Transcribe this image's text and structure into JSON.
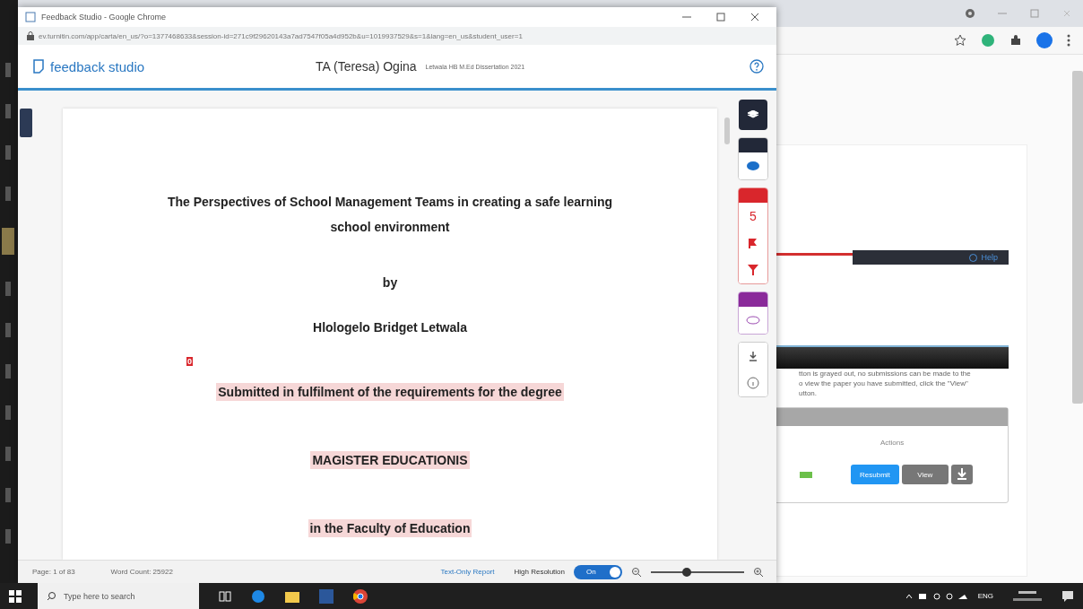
{
  "popup": {
    "title": "Feedback Studio - Google Chrome",
    "url": "ev.turnitin.com/app/carta/en_us/?o=1377468633&session-id=271c9f29620143a7ad7547f05a4d952b&u=1019937529&s=1&lang=en_us&student_user=1"
  },
  "header": {
    "brand": "feedback studio",
    "student": "TA (Teresa) Ogina",
    "assignment": "Letwala HB M.Ed Dissertation 2021"
  },
  "document": {
    "marker": "0",
    "lines": [
      {
        "text": "The Perspectives of School Management Teams in creating a safe learning school environment",
        "highlighted": false
      },
      {
        "text": "by",
        "highlighted": false
      },
      {
        "text": "Hlologelo Bridget Letwala",
        "highlighted": false
      },
      {
        "text": "Submitted in fulfilment of the requirements for the degree",
        "highlighted": true
      },
      {
        "text": "MAGISTER EDUCATIONIS",
        "highlighted": true
      },
      {
        "text": "in the Faculty of Education",
        "highlighted": true
      }
    ]
  },
  "toolbar": {
    "match_count": "5"
  },
  "status_bar": {
    "page": "Page: 1 of 83",
    "word_count": "Word Count: 25922",
    "report_link": "Text-Only Report",
    "resolution_label": "High Resolution",
    "toggle": {
      "label": "On",
      "on": true
    },
    "zoom": {
      "level": 0.38
    }
  },
  "background_page": {
    "header_link": "Help",
    "notice": [
      "tton is grayed out, no submissions can be made to the",
      "o view the paper you have submitted, click the \"View\"",
      "utton."
    ],
    "column": "Actions",
    "buttons": [
      "Resubmit",
      "View"
    ]
  },
  "taskbar": {
    "search_placeholder": "Type here to search",
    "language": "ENG"
  }
}
